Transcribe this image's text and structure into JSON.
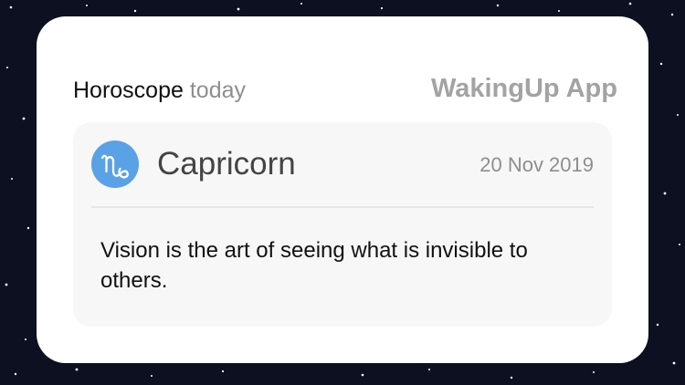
{
  "widget": {
    "title_strong": "Horoscope",
    "title_muted": "today",
    "brand": "WakingUp App"
  },
  "card": {
    "sign_icon": "capricorn-zodiac-icon",
    "sign_name": "Capricorn",
    "date": "20 Nov 2019",
    "message": "Vision is the art of seeing what is invisible to others."
  },
  "colors": {
    "background": "#0c1020",
    "widget": "#ffffff",
    "card": "#f7f7f7",
    "badge": "#5aa1e6",
    "muted_text": "#8e8e8e",
    "brand_text": "#a3a3a3"
  }
}
